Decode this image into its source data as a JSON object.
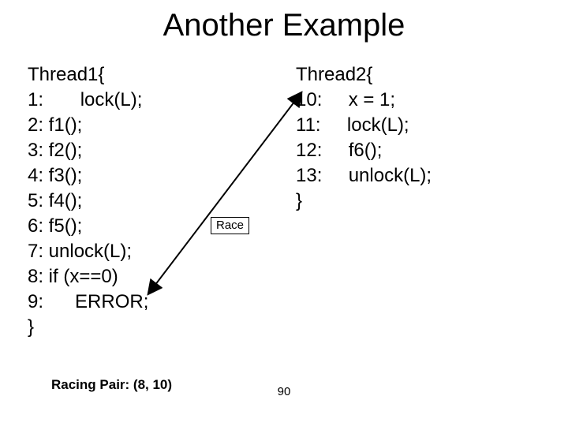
{
  "title": "Another Example",
  "thread1": {
    "lines": [
      "Thread1{",
      "1:       lock(L);",
      "2: f1();",
      "3: f2();",
      "4: f3();",
      "5: f4();",
      "6: f5();",
      "7: unlock(L);",
      "8: if (x==0)",
      "9:      ERROR;",
      "}"
    ]
  },
  "thread2": {
    "lines": [
      "Thread2{",
      "10:     x = 1;",
      "11:     lock(L);",
      "12:     f6();",
      "13:     unlock(L);",
      "}"
    ]
  },
  "race_label": "Race",
  "racing_pair": "Racing Pair: (8, 10)",
  "page_number": "90"
}
